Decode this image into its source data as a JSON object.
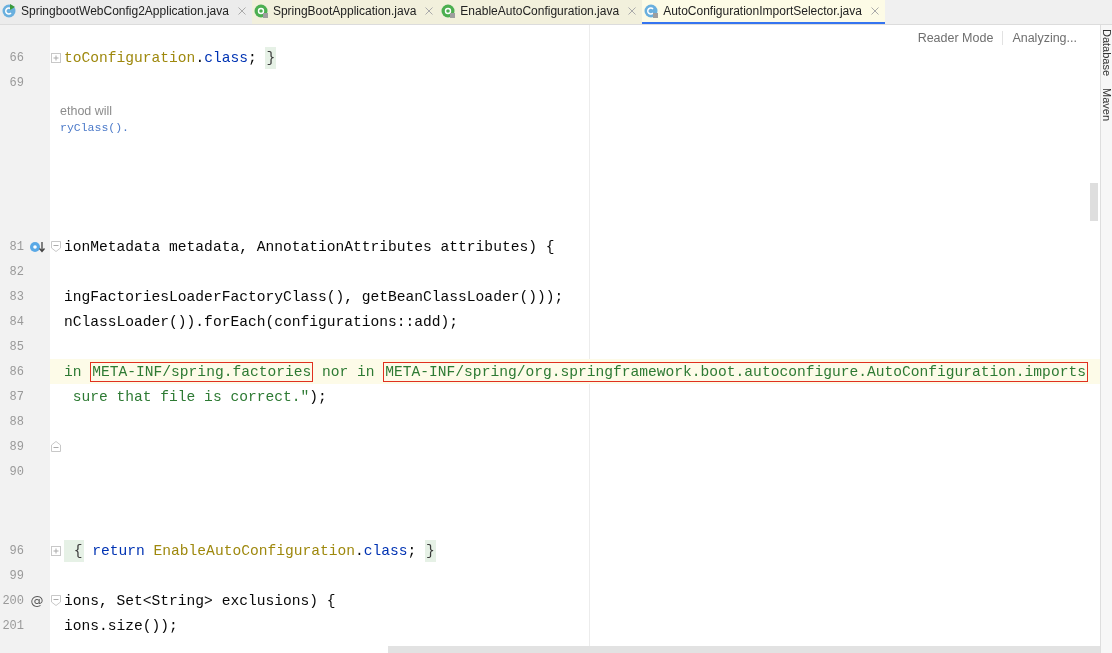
{
  "tabs": [
    {
      "label": "SpringbootWebConfig2Application.java",
      "kind": "runnable",
      "selected": false
    },
    {
      "label": "SpringBootApplication.java",
      "kind": "annotation",
      "selected": false
    },
    {
      "label": "EnableAutoConfiguration.java",
      "kind": "annotation",
      "selected": false
    },
    {
      "label": "AutoConfigurationImportSelector.java",
      "kind": "class",
      "selected": true
    }
  ],
  "editor_actions": [
    "Reader Mode",
    "Analyzing..."
  ],
  "blocks": [
    {
      "kind": "code",
      "lines": [
        {
          "number": "66",
          "kind": "collapsed",
          "current": false,
          "tokens": [
            {
              "kind": "class",
              "text": "toConfiguration"
            },
            {
              "kind": "plain",
              "text": "."
            },
            {
              "kind": "keyword",
              "text": "class"
            },
            {
              "kind": "plain",
              "text": "; "
            },
            {
              "kind": "folded",
              "text": "}"
            }
          ]
        },
        {
          "number": "69",
          "kind": "plain",
          "current": false
        }
      ]
    },
    {
      "kind": "doc",
      "lines": [
        {
          "kind": "prose",
          "text": "ethod will"
        },
        {
          "kind": "link",
          "text": "ryClass()."
        }
      ]
    },
    {
      "kind": "code",
      "lines": [
        {
          "number": "81",
          "kind": "implementing",
          "current": false,
          "tokens": [
            {
              "kind": "plain",
              "text": "ionMetadata metadata, AnnotationAttributes attributes) {"
            }
          ]
        },
        {
          "number": "82",
          "kind": "plain",
          "current": false
        },
        {
          "number": "83",
          "kind": "plain",
          "current": false,
          "tokens": [
            {
              "kind": "plain",
              "text": "ingFactoriesLoaderFactoryClass(), getBeanClassLoader()));"
            }
          ]
        },
        {
          "number": "84",
          "kind": "plain",
          "current": false,
          "tokens": [
            {
              "kind": "plain",
              "text": "nClassLoader()).forEach(configurations::add);"
            }
          ]
        },
        {
          "number": "85",
          "kind": "plain",
          "current": false
        },
        {
          "number": "86",
          "kind": "plain",
          "current": true,
          "tokens": [
            {
              "kind": "string",
              "text": "in "
            },
            {
              "kind": "boxed",
              "text": "META-INF/spring.factories"
            },
            {
              "kind": "string",
              "text": " nor in "
            },
            {
              "kind": "boxed",
              "text": "META-INF/spring/org.springframework.boot.autoconfigure.AutoConfiguration.imports"
            }
          ]
        },
        {
          "number": "87",
          "kind": "plain",
          "current": false,
          "tokens": [
            {
              "kind": "string",
              "text": " sure that file is correct.\""
            },
            {
              "kind": "plain",
              "text": ");"
            }
          ]
        },
        {
          "number": "88",
          "kind": "plain",
          "current": false
        },
        {
          "number": "89",
          "kind": "fold-end",
          "current": false
        },
        {
          "number": "90",
          "kind": "plain",
          "current": false
        }
      ]
    },
    {
      "kind": "code",
      "lines": [
        {
          "number": "96",
          "kind": "collapsed",
          "current": false,
          "tokens": [
            {
              "kind": "folded",
              "text": " {"
            },
            {
              "kind": "keyword",
              "text": " return "
            },
            {
              "kind": "class",
              "text": "EnableAutoConfiguration"
            },
            {
              "kind": "plain",
              "text": "."
            },
            {
              "kind": "keyword",
              "text": "class"
            },
            {
              "kind": "plain",
              "text": "; "
            },
            {
              "kind": "folded",
              "text": "}"
            }
          ]
        },
        {
          "number": "99",
          "kind": "plain",
          "current": false
        },
        {
          "number": "200",
          "kind": "override",
          "gutter_mark": "@",
          "current": false,
          "tokens": [
            {
              "kind": "plain",
              "text": "ions, Set<String> exclusions) {"
            }
          ]
        },
        {
          "number": "201",
          "kind": "plain",
          "current": false,
          "tokens": [
            {
              "kind": "plain",
              "text": "ions.size());"
            }
          ]
        }
      ]
    }
  ],
  "tool_strip": [
    "Database",
    "Maven"
  ]
}
